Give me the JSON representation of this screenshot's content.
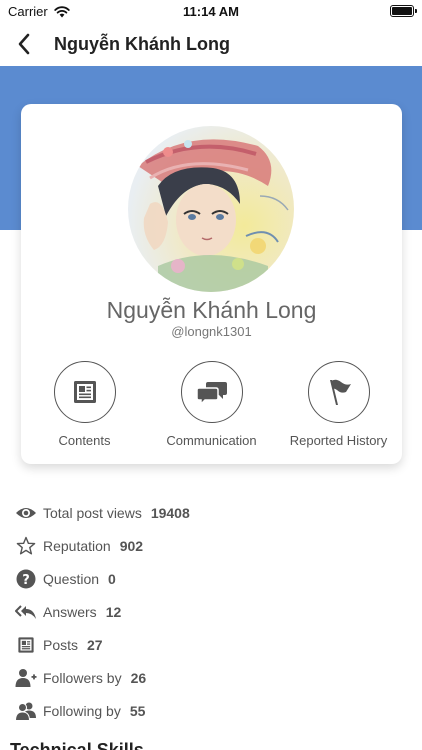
{
  "status_bar": {
    "carrier": "Carrier",
    "time": "11:14 AM"
  },
  "nav": {
    "title": "Nguyễn Khánh Long"
  },
  "profile": {
    "name": "Nguyễn Khánh Long",
    "handle": "@longnk1301"
  },
  "actions": [
    {
      "label": "Contents",
      "icon": "document-icon"
    },
    {
      "label": "Communication",
      "icon": "chat-bubbles-icon"
    },
    {
      "label": "Reported History",
      "icon": "flag-icon"
    }
  ],
  "stats": [
    {
      "label": "Total post views",
      "value": "19408",
      "icon": "eye-icon"
    },
    {
      "label": "Reputation",
      "value": "902",
      "icon": "star-icon"
    },
    {
      "label": "Question",
      "value": "0",
      "icon": "question-icon"
    },
    {
      "label": "Answers",
      "value": "12",
      "icon": "reply-all-icon"
    },
    {
      "label": "Posts",
      "value": "27",
      "icon": "document-icon"
    },
    {
      "label": "Followers by",
      "value": "26",
      "icon": "add-user-icon"
    },
    {
      "label": "Following by",
      "value": "55",
      "icon": "users-icon"
    }
  ],
  "sections": {
    "technical_skills": "Technical Skills"
  },
  "colors": {
    "banner": "#5b8bd0",
    "icon": "#555555",
    "card_bg": "#ffffff"
  }
}
